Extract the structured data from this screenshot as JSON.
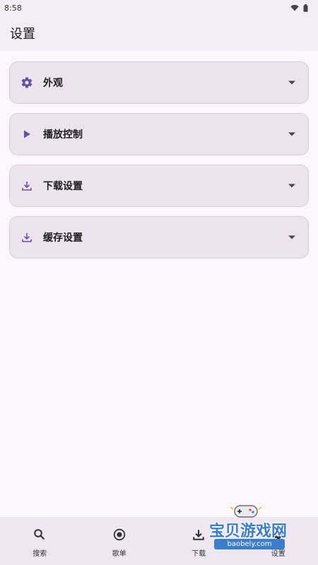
{
  "status_bar": {
    "time": "8:58"
  },
  "header": {
    "title": "设置"
  },
  "settings": {
    "items": [
      {
        "label": "外观",
        "icon": "gear-icon"
      },
      {
        "label": "播放控制",
        "icon": "play-icon"
      },
      {
        "label": "下载设置",
        "icon": "download-icon"
      },
      {
        "label": "缓存设置",
        "icon": "download-icon"
      }
    ]
  },
  "nav": {
    "items": [
      {
        "label": "搜索",
        "icon": "search-icon"
      },
      {
        "label": "歌单",
        "icon": "radio-icon"
      },
      {
        "label": "下载",
        "icon": "download-icon"
      },
      {
        "label": "设置",
        "icon": "gear-icon"
      }
    ]
  },
  "watermark": {
    "text": "宝贝游戏网",
    "url": "baobely.com"
  },
  "colors": {
    "accent": "#6750a4",
    "card_bg": "#ebe4ec",
    "page_bg": "#fbf6fc"
  }
}
